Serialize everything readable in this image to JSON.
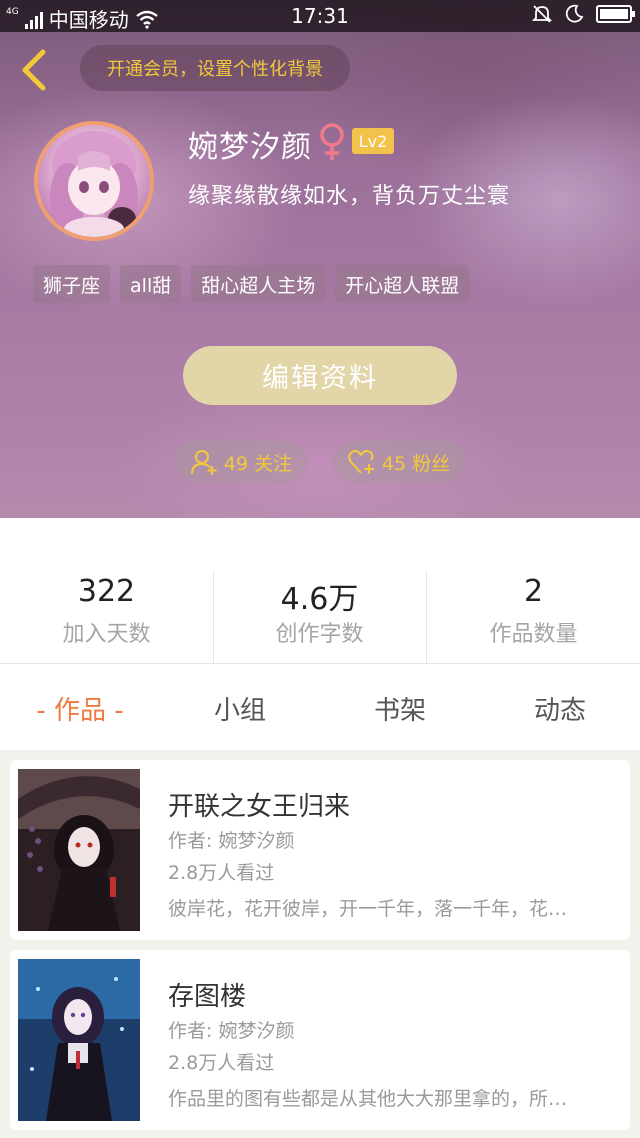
{
  "status_bar": {
    "network": "4G",
    "carrier": "中国移动",
    "time": "17:31"
  },
  "header": {
    "vip_prompt": "开通会员，设置个性化背景",
    "username": "婉梦汐颜",
    "gender_icon": "female-icon",
    "level": "Lv2",
    "signature": "缘聚缘散缘如水，背负万丈尘寰",
    "tags": [
      "狮子座",
      "all甜",
      "甜心超人主场",
      "开心超人联盟"
    ],
    "edit_button": "编辑资料",
    "following": "49 关注",
    "fans": "45 粉丝"
  },
  "stats": [
    {
      "value": "322",
      "label": "加入天数"
    },
    {
      "value": "4.6万",
      "label": "创作字数"
    },
    {
      "value": "2",
      "label": "作品数量"
    }
  ],
  "tabs": [
    "- 作品 -",
    "小组",
    "书架",
    "动态"
  ],
  "works": [
    {
      "title": "开联之女王归来",
      "author": "作者: 婉梦汐颜",
      "views": "2.8万人看过",
      "description": "彼岸花，花开彼岸，开一千年，落一千年，花…"
    },
    {
      "title": "存图楼",
      "author": "作者: 婉梦汐颜",
      "views": "2.8万人看过",
      "description": "作品里的图有些都是从其他大大那里拿的，所…"
    }
  ],
  "colors": {
    "accent_orange": "#f07a40",
    "gold": "#f3c93a",
    "edit_button": "#e2d5a8"
  }
}
